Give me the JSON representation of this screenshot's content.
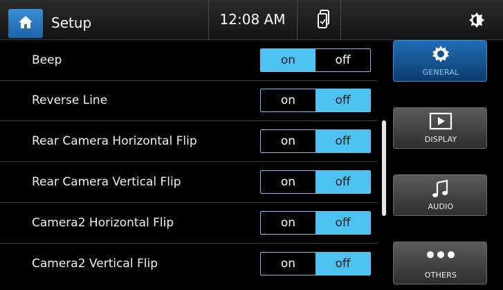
{
  "header": {
    "title": "Setup",
    "time": "12:08 AM",
    "home_icon": "home-icon",
    "phone_icon": "phone-link-icon",
    "brightness_icon": "brightness-icon"
  },
  "settings": [
    {
      "label": "Beep",
      "on_label": "on",
      "off_label": "off",
      "value": "on"
    },
    {
      "label": "Reverse Line",
      "on_label": "on",
      "off_label": "off",
      "value": "off"
    },
    {
      "label": "Rear Camera Horizontal Flip",
      "on_label": "on",
      "off_label": "off",
      "value": "off"
    },
    {
      "label": "Rear Camera Vertical Flip",
      "on_label": "on",
      "off_label": "off",
      "value": "off"
    },
    {
      "label": "Camera2 Horizontal Flip",
      "on_label": "on",
      "off_label": "off",
      "value": "off"
    },
    {
      "label": "Camera2 Vertical Flip",
      "on_label": "on",
      "off_label": "off",
      "value": "off"
    }
  ],
  "sidebar": {
    "items": [
      {
        "label": "GENERAL",
        "icon": "gear-icon",
        "active": true
      },
      {
        "label": "DISPLAY",
        "icon": "play-screen-icon",
        "active": false
      },
      {
        "label": "AUDIO",
        "icon": "music-note-icon",
        "active": false
      },
      {
        "label": "OTHERS",
        "icon": "more-dots-icon",
        "active": false
      }
    ]
  },
  "colors": {
    "accent": "#4cc2f1",
    "header_bg": "#1f1f1f",
    "active_tab": "#1f6db5"
  }
}
